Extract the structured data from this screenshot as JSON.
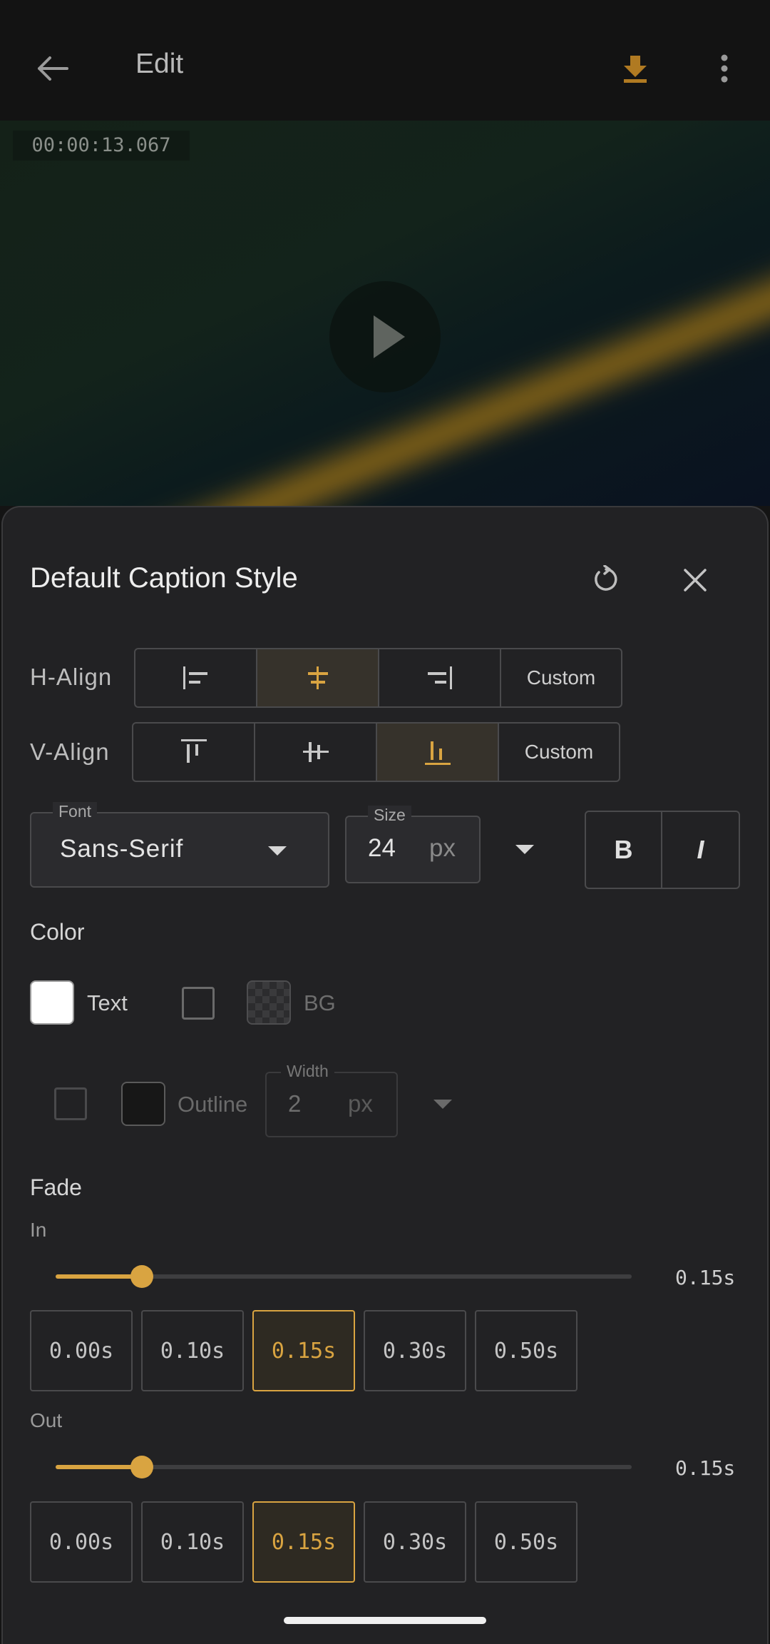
{
  "app_bar": {
    "title": "Edit"
  },
  "video": {
    "timecode": "00:00:13.067"
  },
  "sheet": {
    "title": "Default Caption Style",
    "h_align": {
      "label": "H-Align",
      "options": [
        "align-left",
        "align-center",
        "align-right",
        "Custom"
      ],
      "custom_label": "Custom",
      "selected": "align-center"
    },
    "v_align": {
      "label": "V-Align",
      "options": [
        "align-top",
        "align-middle",
        "align-bottom",
        "Custom"
      ],
      "custom_label": "Custom",
      "selected": "align-bottom"
    },
    "font": {
      "label": "Font",
      "value": "Sans-Serif"
    },
    "size": {
      "label": "Size",
      "value": "24",
      "unit": "px"
    },
    "style_buttons": {
      "bold": "B",
      "italic": "I"
    },
    "color": {
      "label": "Color",
      "text_label": "Text",
      "text_color": "#FFFFFF",
      "bg_label": "BG",
      "bg_enabled": false,
      "outline_label": "Outline",
      "outline_enabled": false,
      "outline_color": "#171717",
      "width_label": "Width",
      "width_value": "2",
      "width_unit": "px"
    },
    "fade": {
      "label": "Fade",
      "in": {
        "label": "In",
        "value_text": "0.15s",
        "fraction": 0.15,
        "presets": [
          "0.00s",
          "0.10s",
          "0.15s",
          "0.30s",
          "0.50s"
        ],
        "selected": "0.15s"
      },
      "out": {
        "label": "Out",
        "value_text": "0.15s",
        "fraction": 0.15,
        "presets": [
          "0.00s",
          "0.10s",
          "0.15s",
          "0.30s",
          "0.50s"
        ],
        "selected": "0.15s"
      }
    }
  },
  "colors": {
    "accent": "#D9A441",
    "sheet_bg": "#222224",
    "app_bg": "#131313"
  }
}
